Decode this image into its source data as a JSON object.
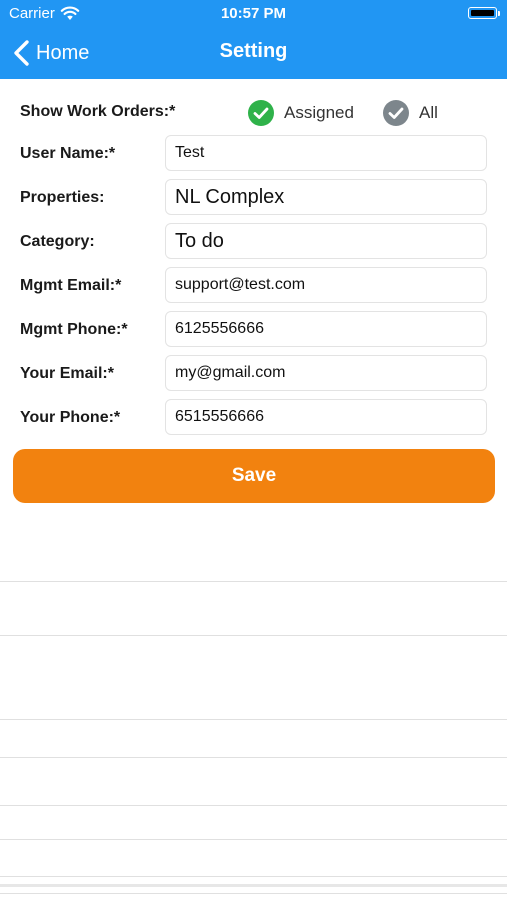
{
  "status_bar": {
    "carrier": "Carrier",
    "time": "10:57 PM"
  },
  "nav": {
    "back_label": "Home",
    "title": "Setting"
  },
  "show_work_orders": {
    "label": "Show Work Orders:*",
    "options": [
      {
        "label": "Assigned",
        "selected": true,
        "color": "#2fb24a"
      },
      {
        "label": "All",
        "selected": false,
        "color": "#7d868c"
      }
    ]
  },
  "fields": {
    "user_name": {
      "label": "User Name:*",
      "value": "Test"
    },
    "properties": {
      "label": "Properties:",
      "value": "NL Complex"
    },
    "category": {
      "label": "Category:",
      "value": "To do"
    },
    "mgmt_email": {
      "label": "Mgmt Email:*",
      "value": "support@test.com"
    },
    "mgmt_phone": {
      "label": "Mgmt Phone:*",
      "value": "6125556666"
    },
    "your_email": {
      "label": "Your Email:*",
      "value": "my@gmail.com"
    },
    "your_phone": {
      "label": "Your Phone:*",
      "value": "6515556666"
    }
  },
  "save_label": "Save",
  "colors": {
    "nav_bar": "#2196f3",
    "save_button": "#f2820f"
  }
}
